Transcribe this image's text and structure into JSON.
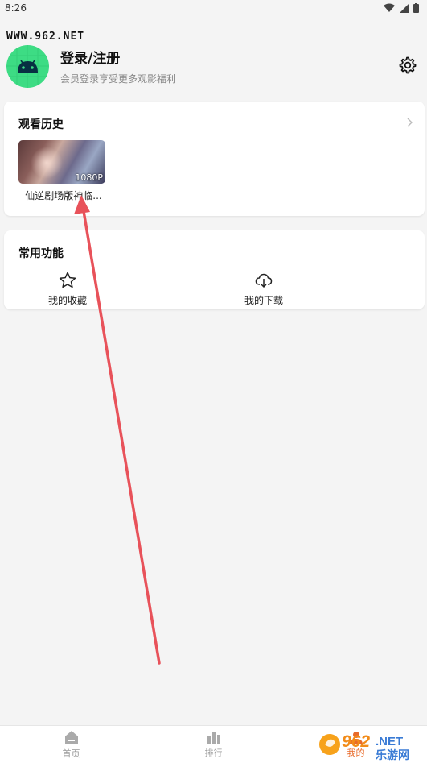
{
  "status_bar": {
    "time": "8:26"
  },
  "watermark": {
    "top_text": "WWW.962.NET",
    "logo_num": "962",
    "logo_net": ".NET",
    "logo_cn": "乐游网"
  },
  "profile": {
    "title": "登录/注册",
    "subtitle": "会员登录享受更多观影福利"
  },
  "history": {
    "title": "观看历史",
    "items": [
      {
        "title": "仙逆剧场版神临...",
        "resolution": "1080P"
      }
    ]
  },
  "functions": {
    "title": "常用功能",
    "items": [
      {
        "label": "我的收藏",
        "icon": "star-icon"
      },
      {
        "label": "我的下载",
        "icon": "cloud-download-icon"
      }
    ]
  },
  "bottom_nav": {
    "items": [
      {
        "label": "首页",
        "icon": "home-icon",
        "active": false
      },
      {
        "label": "排行",
        "icon": "ranking-icon",
        "active": false
      },
      {
        "label": "我的",
        "icon": "profile-icon",
        "active": true
      }
    ]
  },
  "colors": {
    "accent": "#e86a2a",
    "avatar": "#3ddc84",
    "arrow": "#e8525a"
  }
}
